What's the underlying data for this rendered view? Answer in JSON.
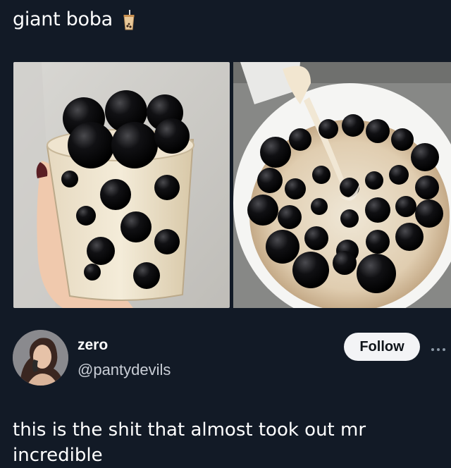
{
  "caption": {
    "text": "giant boba",
    "emoji_icon": "bubble-tea-icon"
  },
  "images": {
    "left": {
      "description_icon": "boba-cup-photo"
    },
    "right": {
      "description_icon": "boba-bowl-milk-photo"
    }
  },
  "author": {
    "display_name": "zero",
    "handle": "@pantydevils",
    "follow_label": "Follow",
    "more_icon": "more-options-icon"
  },
  "tweet": {
    "text": "this is the shit that almost took out mr incredible"
  },
  "colors": {
    "background": "#121a26",
    "follow_button_bg": "#f3f4f6",
    "handle_text": "#c9ced6"
  }
}
